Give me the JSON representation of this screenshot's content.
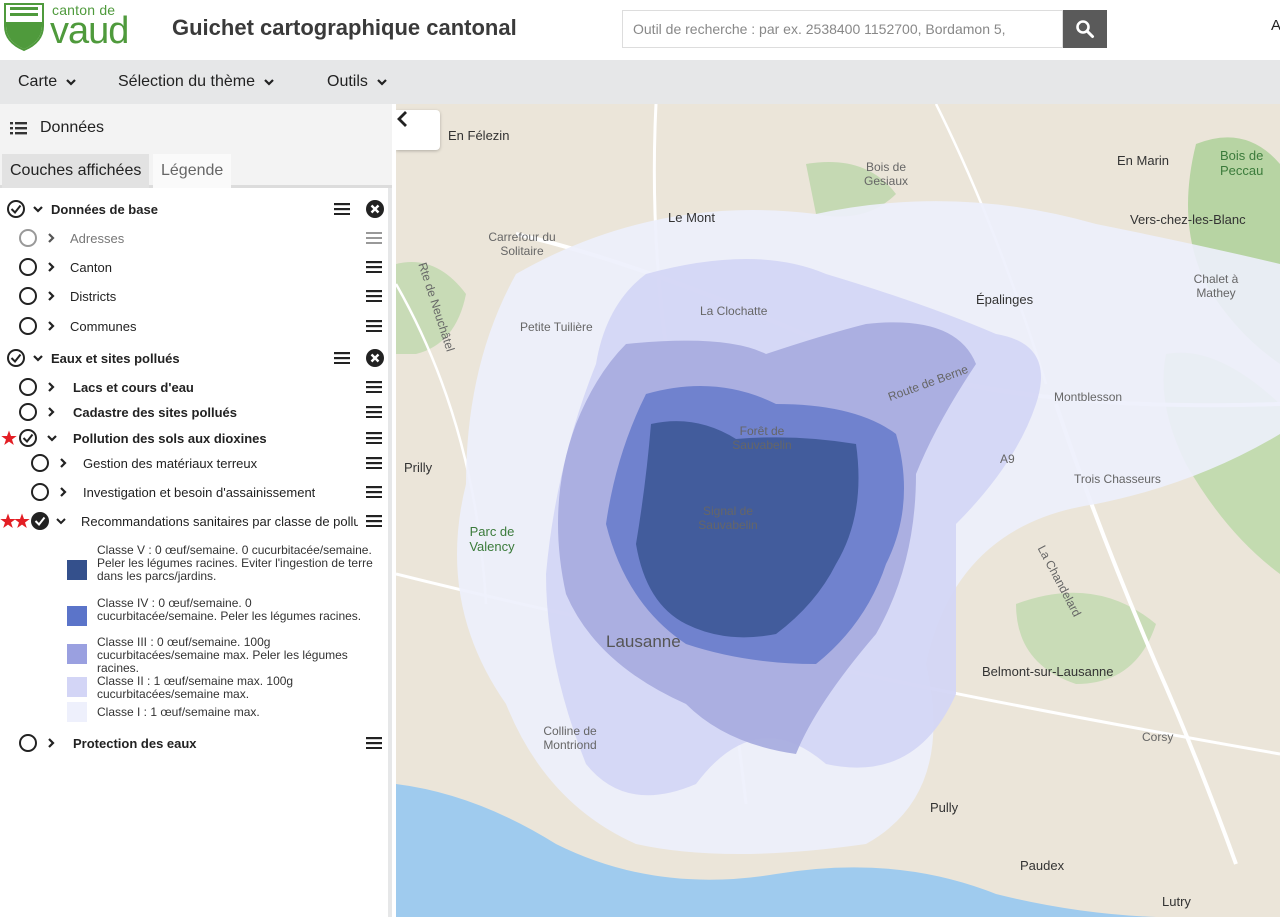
{
  "header": {
    "logo_small": "canton de",
    "logo_big": "vaud",
    "title": "Guichet cartographique cantonal",
    "search_placeholder": "Outil de recherche : par ex. 2538400 1152700, Bordamon 5,",
    "search_icon": "search-icon",
    "corner_letter": "A"
  },
  "menubar": {
    "items": [
      {
        "label": "Carte"
      },
      {
        "label": "Sélection du thème"
      },
      {
        "label": "Outils"
      }
    ]
  },
  "sidebar": {
    "title": "Données",
    "tabs": [
      "Couches affichées",
      "Légende"
    ],
    "groups": [
      {
        "label": "Données de base",
        "checked": true,
        "children": [
          "Adresses",
          "Canton",
          "Districts",
          "Communes"
        ]
      },
      {
        "label": "Eaux et sites pollués",
        "checked": true,
        "children_top": [
          "Lacs et cours d'eau",
          "Cadastre des sites pollués"
        ],
        "dioxin_layer": "Pollution des sols aux dioxines",
        "dioxin_children": [
          "Gestion des matériaux terreux",
          "Investigation et besoin d'assainissement"
        ],
        "reco_layer": "Recommandations sanitaires par classe de pollu",
        "legend": [
          {
            "color": "#34508c",
            "text": "Classe V : 0 œuf/semaine. 0 cucurbitacée/semaine. Peler les légumes racines. Eviter l'ingestion de terre dans les parcs/jardins."
          },
          {
            "color": "#5b74c9",
            "text": "Classe IV : 0 œuf/semaine. 0 cucurbitacée/semaine. Peler les légumes racines."
          },
          {
            "color": "#9aa0e0",
            "text": "Classe III : 0 œuf/semaine. 100g cucurbitacées/semaine max. Peler les légumes racines."
          },
          {
            "color": "#d3d5f6",
            "text": "Classe II : 1 œuf/semaine max. 100g cucurbitacées/semaine max."
          },
          {
            "color": "#eef0fc",
            "text": "Classe I : 1 œuf/semaine max."
          }
        ],
        "last_layer": "Protection des eaux"
      }
    ]
  },
  "map": {
    "labels": [
      "En Félezin",
      "Bois de Gesiaux",
      "En Marin",
      "Bois de Peccau",
      "Le Mont",
      "Vers-chez-les-Blanc",
      "Carrefour du Solitaire",
      "Chalet à Mathey",
      "Épalinges",
      "Petite Tuilière",
      "La Clochatte",
      "Route de Berne",
      "Montblesson",
      "Forêt de Sauvabelin",
      "Prilly",
      "A9",
      "Trois Chasseurs",
      "Signal de Sauvabelin",
      "Parc de Valency",
      "La Chandelard",
      "Lausanne",
      "Belmont-sur-Lausanne",
      "Colline de Montriond",
      "Corsy",
      "Pully",
      "Paudex",
      "Lutry",
      "Rte de Neuchâtel"
    ]
  }
}
